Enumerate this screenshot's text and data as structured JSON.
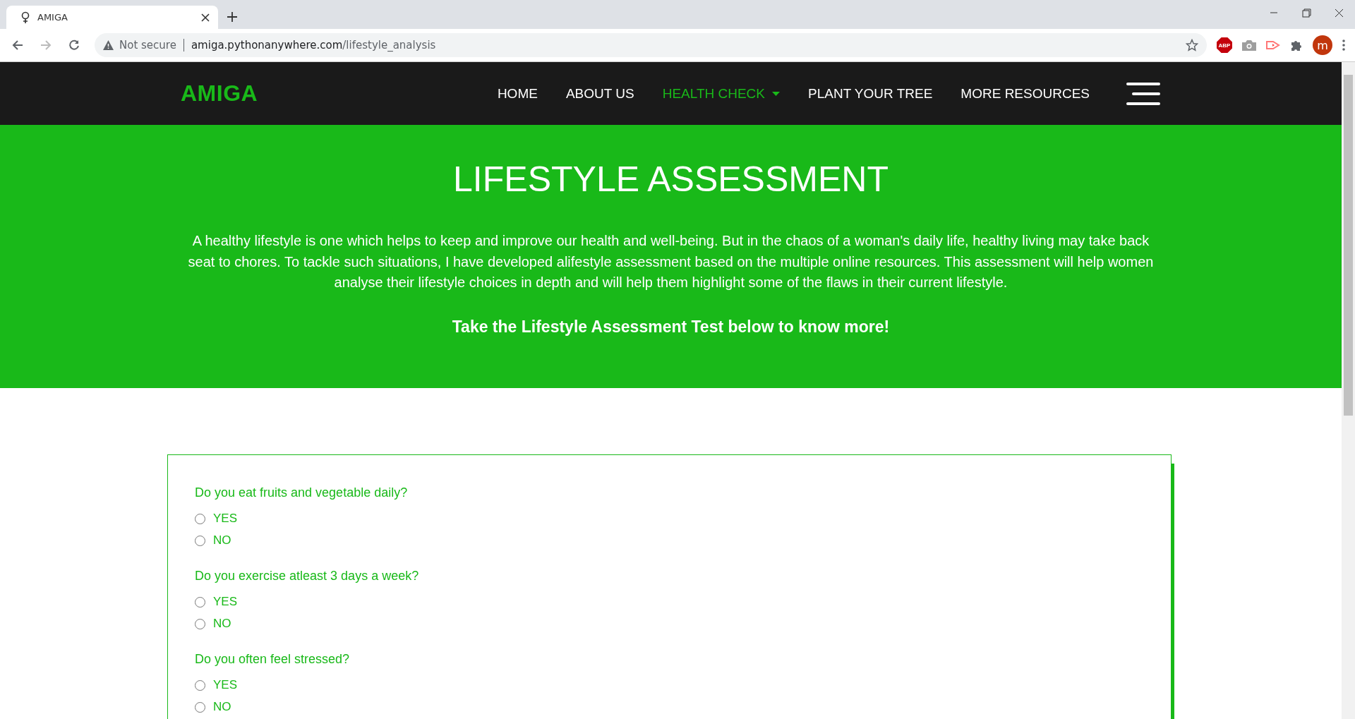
{
  "browser": {
    "tab_title": "AMIGA",
    "security": "Not secure",
    "url_host": "amiga.pythonanywhere.com",
    "url_path": "/lifestyle_analysis",
    "adblock_label": "ABP",
    "avatar_letter": "m"
  },
  "nav": {
    "logo": "AMIGA",
    "items": [
      {
        "label": "HOME",
        "selected": false,
        "dropdown": false
      },
      {
        "label": "ABOUT US",
        "selected": false,
        "dropdown": false
      },
      {
        "label": "HEALTH CHECK",
        "selected": true,
        "dropdown": true
      },
      {
        "label": "PLANT YOUR TREE",
        "selected": false,
        "dropdown": false
      },
      {
        "label": "MORE RESOURCES",
        "selected": false,
        "dropdown": false
      }
    ]
  },
  "hero": {
    "title": "LIFESTYLE ASSESSMENT",
    "description": "A healthy lifestyle is one which helps to keep and improve our health and well-being. But in the chaos of a woman's daily life, healthy living may take back seat to chores. To tackle such situations, I have developed alifestyle assessment based on the multiple online resources. This assessment will help women analyse their lifestyle choices in depth and will help them highlight some of the flaws in their current lifestyle.",
    "call_to_action": "Take the Lifestyle Assessment Test below to know more!"
  },
  "questions": [
    {
      "text": "Do you eat fruits and vegetable daily?",
      "options": [
        {
          "label": "YES",
          "selected": false
        },
        {
          "label": "NO",
          "selected": false
        }
      ]
    },
    {
      "text": "Do you exercise atleast 3 days a week?",
      "options": [
        {
          "label": "YES",
          "selected": false
        },
        {
          "label": "NO",
          "selected": false
        }
      ]
    },
    {
      "text": "Do you often feel stressed?",
      "options": [
        {
          "label": "YES",
          "selected": false
        },
        {
          "label": "NO",
          "selected": false
        }
      ]
    }
  ]
}
